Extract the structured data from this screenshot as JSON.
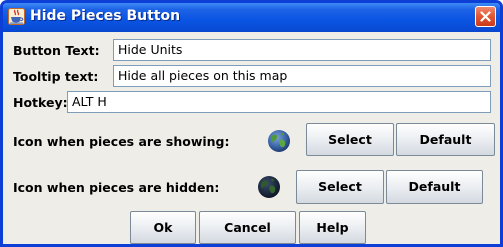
{
  "window": {
    "title": "Hide Pieces Button",
    "app_icon": "java-cup-icon",
    "close_icon": "close-icon"
  },
  "form": {
    "button_text_label": "Button Text:",
    "button_text_value": "Hide Units",
    "tooltip_label": "Tooltip text:",
    "tooltip_value": "Hide all pieces on this map",
    "hotkey_label": "Hotkey:",
    "hotkey_value": "ALT H",
    "showing_icon": {
      "label": "Icon when pieces are showing:",
      "icon": "globe-icon",
      "select_label": "Select",
      "default_label": "Default"
    },
    "hidden_icon": {
      "label": "Icon when pieces are hidden:",
      "icon": "dark-globe-icon",
      "select_label": "Select",
      "default_label": "Default"
    }
  },
  "actions": {
    "ok_label": "Ok",
    "cancel_label": "Cancel",
    "help_label": "Help"
  }
}
